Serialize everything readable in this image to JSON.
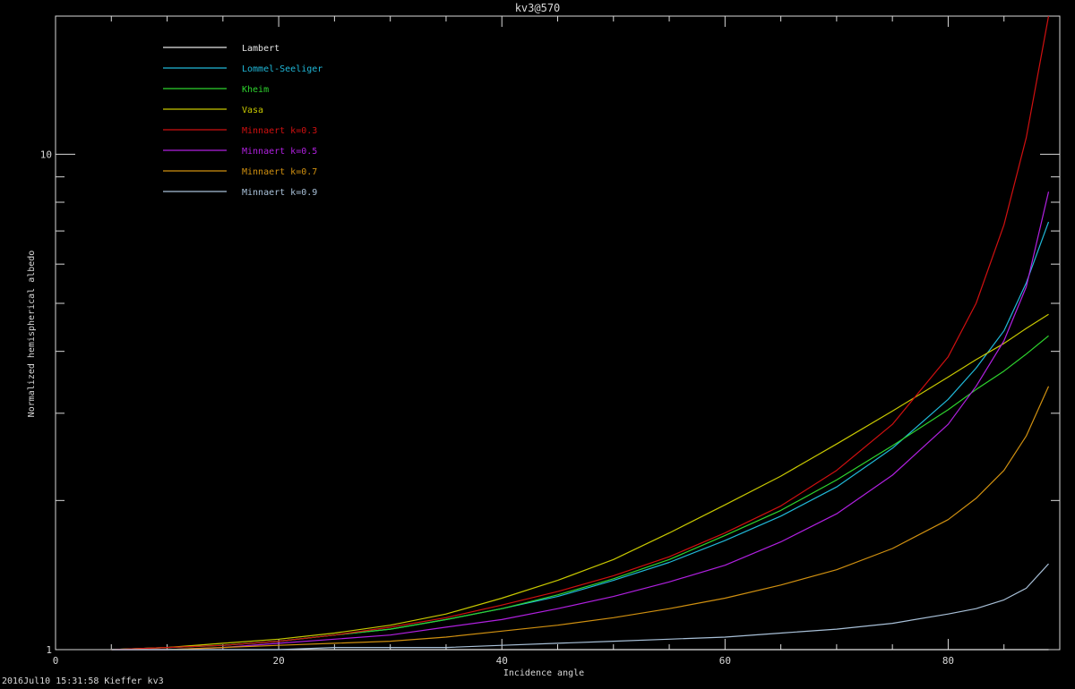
{
  "window": {
    "title": "kv3@570",
    "footer": "2016Jul10 15:31:58 Kieffer kv3"
  },
  "chart_data": {
    "type": "line",
    "title": "kv3@570",
    "xlabel": "Incidence angle",
    "ylabel": "Normalized hemispherical albedo",
    "xlim": [
      0,
      90
    ],
    "ylim": [
      1,
      19
    ],
    "yscale": "log",
    "x_ticks": [
      0,
      20,
      40,
      60,
      80
    ],
    "x_tick_labels": [
      "0",
      "20",
      "40",
      "60",
      "80"
    ],
    "y_major_ticks": [
      1,
      10
    ],
    "y_tick_labels": [
      "1",
      "10"
    ],
    "y_minor_ticks": [
      2,
      3,
      4,
      5,
      6,
      7,
      8,
      9
    ],
    "grid": false,
    "legend_position": "top-left",
    "x": [
      5,
      10,
      15,
      20,
      25,
      30,
      35,
      40,
      45,
      50,
      55,
      60,
      65,
      70,
      75,
      80,
      82.5,
      85,
      87,
      89
    ],
    "series": [
      {
        "name": "Lambert",
        "color": "#e6e6e6",
        "values": [
          1.0,
          1.0,
          1.0,
          1.0,
          1.0,
          1.0,
          1.0,
          1.0,
          1.0,
          1.0,
          1.0,
          1.0,
          1.0,
          1.0,
          1.0,
          1.0,
          1.0,
          1.0,
          1.0,
          1.0
        ]
      },
      {
        "name": "Lommel-Seeliger",
        "color": "#20b8d8",
        "values": [
          1.0,
          1.01,
          1.02,
          1.04,
          1.07,
          1.1,
          1.15,
          1.21,
          1.28,
          1.38,
          1.5,
          1.66,
          1.86,
          2.13,
          2.55,
          3.2,
          3.7,
          4.4,
          5.5,
          7.3
        ]
      },
      {
        "name": "Kheim",
        "color": "#2ed42e",
        "values": [
          1.0,
          1.01,
          1.02,
          1.04,
          1.07,
          1.1,
          1.15,
          1.21,
          1.29,
          1.39,
          1.52,
          1.7,
          1.91,
          2.2,
          2.58,
          3.05,
          3.35,
          3.65,
          3.95,
          4.3
        ]
      },
      {
        "name": "Vasa",
        "color": "#c8c800",
        "values": [
          1.0,
          1.01,
          1.03,
          1.05,
          1.08,
          1.12,
          1.18,
          1.27,
          1.38,
          1.52,
          1.72,
          1.96,
          2.24,
          2.6,
          3.03,
          3.55,
          3.85,
          4.15,
          4.45,
          4.75
        ]
      },
      {
        "name": "Minnaert k=0.3",
        "color": "#d01010",
        "values": [
          1.0,
          1.01,
          1.02,
          1.04,
          1.07,
          1.11,
          1.16,
          1.23,
          1.31,
          1.41,
          1.54,
          1.72,
          1.95,
          2.3,
          2.85,
          3.9,
          5.0,
          7.2,
          10.8,
          19.0
        ]
      },
      {
        "name": "Minnaert k=0.5",
        "color": "#b020e0",
        "values": [
          1.0,
          1.0,
          1.01,
          1.03,
          1.05,
          1.07,
          1.11,
          1.15,
          1.21,
          1.28,
          1.37,
          1.48,
          1.65,
          1.88,
          2.25,
          2.85,
          3.4,
          4.2,
          5.4,
          8.4
        ]
      },
      {
        "name": "Minnaert k=0.7",
        "color": "#d09010",
        "values": [
          1.0,
          1.0,
          1.01,
          1.02,
          1.03,
          1.04,
          1.06,
          1.09,
          1.12,
          1.16,
          1.21,
          1.27,
          1.35,
          1.45,
          1.6,
          1.83,
          2.02,
          2.3,
          2.7,
          3.4
        ]
      },
      {
        "name": "Minnaert k=0.9",
        "color": "#a8c0d8",
        "values": [
          1.0,
          1.0,
          1.0,
          1.0,
          1.01,
          1.01,
          1.01,
          1.02,
          1.03,
          1.04,
          1.05,
          1.06,
          1.08,
          1.1,
          1.13,
          1.18,
          1.21,
          1.26,
          1.33,
          1.49
        ]
      }
    ]
  }
}
